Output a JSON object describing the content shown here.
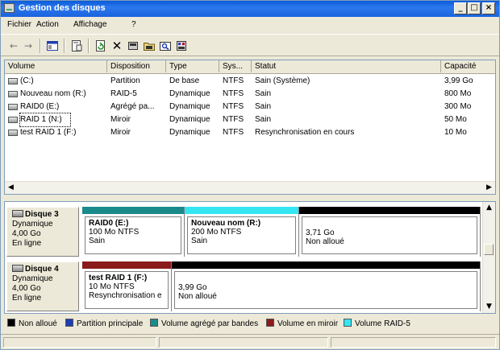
{
  "window": {
    "title": "Gestion des disques",
    "minimize_glyph": "_",
    "restore_glyph": "□",
    "close_glyph": "×"
  },
  "menu": [
    "Fichier",
    "Action",
    "Affichage",
    "?"
  ],
  "toolbar_icons": [
    "back-arrow-icon",
    "forward-arrow-icon",
    "console-tree-icon",
    "properties-icon",
    "refresh-icon",
    "delete-icon",
    "disk-properties-icon",
    "open-folder-icon",
    "explore-icon",
    "settings-icon"
  ],
  "columns": [
    "Volume",
    "Disposition",
    "Type",
    "Sys...",
    "Statut",
    "Capacité"
  ],
  "volumes": [
    {
      "name": "(C:)",
      "layout": "Partition",
      "type": "De base",
      "fs": "NTFS",
      "status": "Sain (Système)",
      "capacity": "3,99 Go"
    },
    {
      "name": "Nouveau nom (R:)",
      "layout": "RAID-5",
      "type": "Dynamique",
      "fs": "NTFS",
      "status": "Sain",
      "capacity": "800 Mo"
    },
    {
      "name": "RAID0 (E:)",
      "layout": "Agrégé pa...",
      "type": "Dynamique",
      "fs": "NTFS",
      "status": "Sain",
      "capacity": "300 Mo"
    },
    {
      "name": "RAID 1 (N:)",
      "layout": "Miroir",
      "type": "Dynamique",
      "fs": "NTFS",
      "status": "Sain",
      "capacity": "50 Mo"
    },
    {
      "name": "test RAID 1 (F:)",
      "layout": "Miroir",
      "type": "Dynamique",
      "fs": "NTFS",
      "status": "Resynchronisation en cours",
      "capacity": "10 Mo"
    }
  ],
  "disks": [
    {
      "name": "Disque 3",
      "kind": "Dynamique",
      "size": "4,00 Go",
      "state": "En ligne",
      "partitions": [
        {
          "title": "RAID0  (E:)",
          "line1": "100 Mo NTFS",
          "line2": "Sain",
          "color": "#1b8a8a"
        },
        {
          "title": "Nouveau nom  (R:)",
          "line1": "200 Mo NTFS",
          "line2": "Sain",
          "color": "#33e6f2"
        },
        {
          "title": "",
          "line1": "3,71 Go",
          "line2": "Non alloué",
          "color": "#000000"
        }
      ]
    },
    {
      "name": "Disque 4",
      "kind": "Dynamique",
      "size": "4,00 Go",
      "state": "En ligne",
      "partitions": [
        {
          "title": "test RAID 1  (F:)",
          "line1": "10 Mo NTFS",
          "line2": "Resynchronisation e",
          "color": "#8b1a1a"
        },
        {
          "title": "",
          "line1": "3,99 Go",
          "line2": "Non alloué",
          "color": "#000000"
        }
      ]
    }
  ],
  "legend": [
    {
      "label": "Non alloué",
      "color": "#000000"
    },
    {
      "label": "Partition principale",
      "color": "#1f3fb0"
    },
    {
      "label": "Volume agrégé par bandes",
      "color": "#1b8a8a"
    },
    {
      "label": "Volume en miroir",
      "color": "#8b1a1a"
    },
    {
      "label": "Volume RAID-5",
      "color": "#33e6f2"
    }
  ]
}
